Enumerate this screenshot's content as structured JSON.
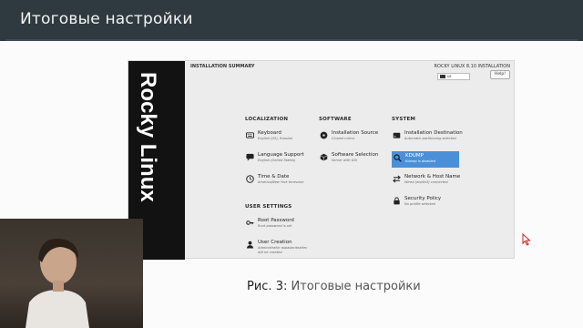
{
  "slide": {
    "title": "Итоговые настройки",
    "caption_num": "Рис. 3:",
    "caption_text": "Итоговые настройки"
  },
  "installer": {
    "brand": "Rocky Linux",
    "summary_title": "INSTALLATION SUMMARY",
    "release": "ROCKY LINUX 8.10 INSTALLATION",
    "keyboard_layout": "us",
    "help_label": "Help!",
    "sections": {
      "localization": "LOCALIZATION",
      "software": "SOFTWARE",
      "system": "SYSTEM",
      "user_settings": "USER SETTINGS"
    },
    "spokes": {
      "keyboard": {
        "name": "Keyboard",
        "status": "English (US), Russian"
      },
      "language": {
        "name": "Language Support",
        "status": "English (United States)"
      },
      "time": {
        "name": "Time & Date",
        "status": "America/New York timezone"
      },
      "source": {
        "name": "Installation Source",
        "status": "Closest mirror"
      },
      "software": {
        "name": "Software Selection",
        "status": "Server with GUI"
      },
      "destination": {
        "name": "Installation Destination",
        "status": "Automatic partitioning selected"
      },
      "kdump": {
        "name": "KDUMP",
        "status": "Kdump is disabled"
      },
      "network": {
        "name": "Network & Host Name",
        "status": "Wired (enp0s3) connected"
      },
      "security": {
        "name": "Security Policy",
        "status": "No profile selected"
      },
      "root": {
        "name": "Root Password",
        "status": "Root password is set"
      },
      "user": {
        "name": "User Creation",
        "status": "Administrator aspadacitealtev will be created"
      }
    },
    "icons": {
      "keyboard": "keyboard-icon",
      "language": "speech-bubble-icon",
      "time": "clock-icon",
      "source": "disc-icon",
      "software": "package-icon",
      "destination": "hard-drive-icon",
      "kdump": "magnifier-icon",
      "network": "network-icon",
      "security": "lock-icon",
      "root": "key-icon",
      "user": "user-icon"
    },
    "colors": {
      "selected": "#4a90d9",
      "brand_bg": "#121212"
    }
  }
}
